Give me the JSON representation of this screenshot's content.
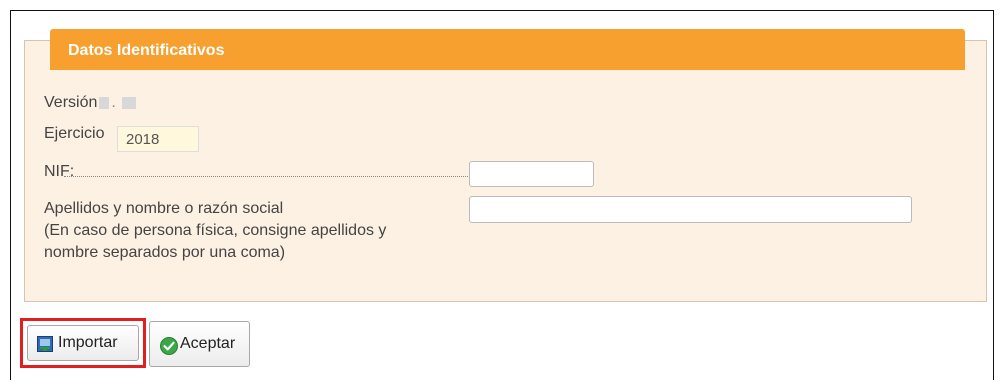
{
  "panel": {
    "title": "Datos Identificativos",
    "version_label": "Versión",
    "version_sep": ".",
    "ejercicio_label": "Ejercicio",
    "ejercicio_value": "2018",
    "nif_label": "NIF:",
    "nif_value": "",
    "nombre_label_line1": "Apellidos y nombre o razón social",
    "nombre_label_line2": "(En caso de persona física, consigne apellidos y",
    "nombre_label_line3": "nombre separados por una coma)",
    "nombre_value": ""
  },
  "actions": {
    "importar_label": "Importar",
    "aceptar_label": "Aceptar"
  },
  "colors": {
    "header": "#f7a030",
    "panel_bg": "#fdf1e4",
    "highlight": "#e02020"
  }
}
